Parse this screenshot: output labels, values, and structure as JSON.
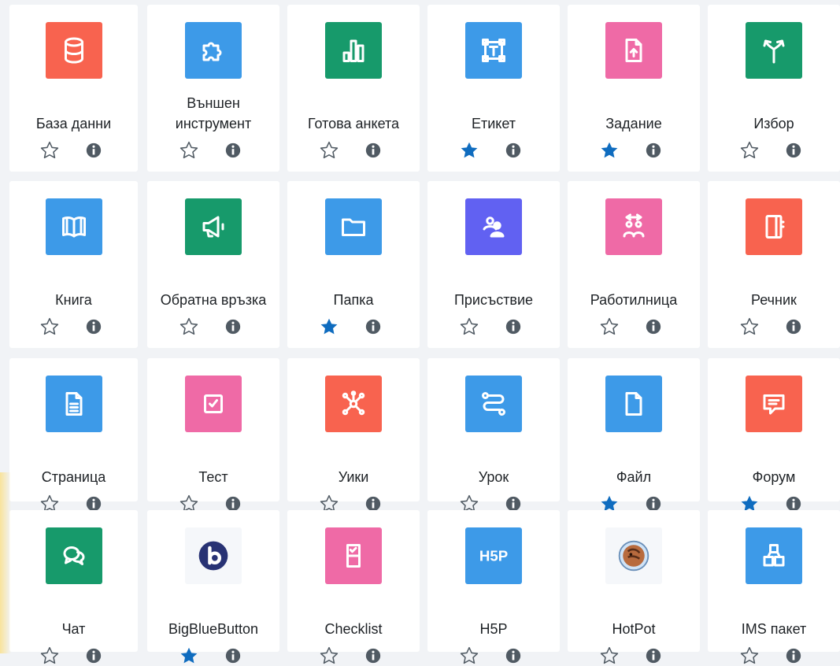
{
  "colors": {
    "red": "#f8634f",
    "blue": "#3d9ae8",
    "green": "#179a6b",
    "pink": "#ef6aa6",
    "purple": "#6161f2",
    "pale": "#f5f7fa",
    "star_on": "#0f6cbf",
    "star_off": "#505a63",
    "info": "#505a63"
  },
  "activities": [
    {
      "label": "База данни",
      "icon": "database-icon",
      "color": "red",
      "starred": false
    },
    {
      "label": "Външен инструмент",
      "icon": "puzzle-icon",
      "color": "blue",
      "starred": false
    },
    {
      "label": "Готова анкета",
      "icon": "bar-chart-icon",
      "color": "green",
      "starred": false
    },
    {
      "label": "Етикет",
      "icon": "text-label-icon",
      "color": "blue",
      "starred": true
    },
    {
      "label": "Задание",
      "icon": "upload-document-icon",
      "color": "pink",
      "starred": true
    },
    {
      "label": "Избор",
      "icon": "signpost-icon",
      "color": "green",
      "starred": false
    },
    {
      "label": "Книга",
      "icon": "book-icon",
      "color": "blue",
      "starred": false
    },
    {
      "label": "Обратна връзка",
      "icon": "megaphone-icon",
      "color": "green",
      "starred": false
    },
    {
      "label": "Папка",
      "icon": "folder-icon",
      "color": "blue",
      "starred": true
    },
    {
      "label": "Присъствие",
      "icon": "attendance-icon",
      "color": "purple",
      "starred": false
    },
    {
      "label": "Работилница",
      "icon": "workshop-icon",
      "color": "pink",
      "starred": false
    },
    {
      "label": "Речник",
      "icon": "glossary-icon",
      "color": "red",
      "starred": false
    },
    {
      "label": "Страница",
      "icon": "page-icon",
      "color": "blue",
      "starred": false
    },
    {
      "label": "Тест",
      "icon": "checkbox-icon",
      "color": "pink",
      "starred": false
    },
    {
      "label": "Уики",
      "icon": "network-icon",
      "color": "red",
      "starred": false
    },
    {
      "label": "Урок",
      "icon": "path-icon",
      "color": "blue",
      "starred": false
    },
    {
      "label": "Файл",
      "icon": "file-icon",
      "color": "blue",
      "starred": true
    },
    {
      "label": "Форум",
      "icon": "forum-icon",
      "color": "red",
      "starred": true
    },
    {
      "label": "Чат",
      "icon": "chat-icon",
      "color": "green",
      "starred": false
    },
    {
      "label": "BigBlueButton",
      "icon": "bigbluebutton-logo-icon",
      "color": "pale",
      "starred": true
    },
    {
      "label": "Checklist",
      "icon": "checklist-icon",
      "color": "pink",
      "starred": false
    },
    {
      "label": "H5P",
      "icon": "h5p-logo-icon",
      "color": "blue",
      "starred": false
    },
    {
      "label": "HotPot",
      "icon": "hotpot-logo-icon",
      "color": "pale",
      "starred": false
    },
    {
      "label": "IMS пакет",
      "icon": "package-icon",
      "color": "blue",
      "starred": false
    }
  ]
}
